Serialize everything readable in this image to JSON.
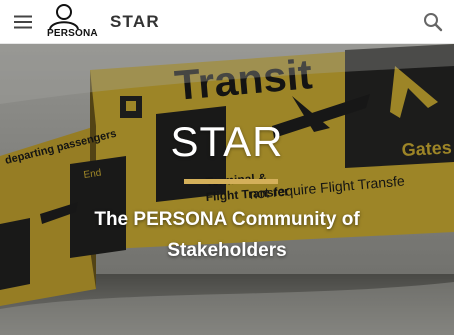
{
  "header": {
    "logo_text": "PERSONA",
    "site_title": "STAR",
    "menu_icon": "hamburger-menu-icon",
    "search_icon": "search-icon"
  },
  "hero": {
    "title": "STAR",
    "subtitle": "The PERSONA Community of Stakeholders",
    "background_signage": {
      "transit_sign": "Transit",
      "gates_sign": "Gates",
      "departing_sign": "departing passengers",
      "end_sign": "End",
      "terminal_sign": "Terminal &",
      "flight_transfer_sign": "Flight Transfer",
      "not_require_sign": "not require Flight Transfe"
    },
    "accent_color": "#d4b05a",
    "sign_color": "#e8c53a"
  }
}
